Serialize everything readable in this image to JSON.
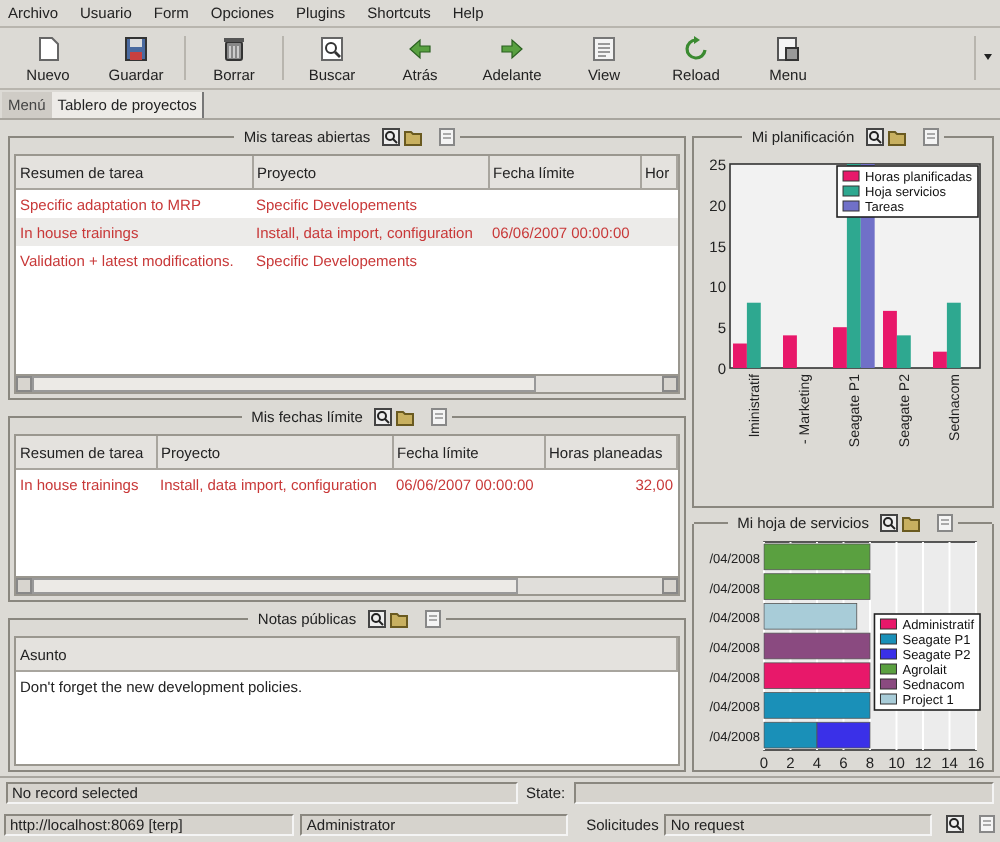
{
  "menu_bar": [
    "Archivo",
    "Usuario",
    "Form",
    "Opciones",
    "Plugins",
    "Shortcuts",
    "Help"
  ],
  "toolbar": [
    {
      "label": "Nuevo",
      "kind": "new"
    },
    {
      "label": "Guardar",
      "kind": "save"
    },
    {
      "label": "Borrar",
      "kind": "delete"
    },
    {
      "label": "Buscar",
      "kind": "search"
    },
    {
      "label": "Atrás",
      "kind": "back"
    },
    {
      "label": "Adelante",
      "kind": "forward"
    },
    {
      "label": "View",
      "kind": "view"
    },
    {
      "label": "Reload",
      "kind": "reload"
    },
    {
      "label": "Menu",
      "kind": "menu"
    }
  ],
  "tabs": [
    {
      "label": "Menú",
      "selected": false
    },
    {
      "label": "Tablero de proyectos",
      "selected": true
    }
  ],
  "open_tasks": {
    "title": "Mis tareas abiertas",
    "columns": [
      "Resumen de tarea",
      "Proyecto",
      "Fecha límite",
      "Hor"
    ],
    "rows": [
      {
        "cells": [
          "Specific adaptation to MRP",
          "Specific Developements",
          ""
        ],
        "selected": false
      },
      {
        "cells": [
          "In house trainings",
          "Install, data import, configuration",
          "06/06/2007 00:00:00"
        ],
        "selected": true
      },
      {
        "cells": [
          "Validation + latest modifications.",
          "Specific Developements",
          ""
        ],
        "selected": false
      }
    ]
  },
  "deadlines": {
    "title": "Mis fechas límite",
    "columns": [
      "Resumen de tarea",
      "Proyecto",
      "Fecha límite",
      "Horas planeadas"
    ],
    "rows": [
      {
        "cells": [
          "In house trainings",
          "Install, data import, configuration",
          "06/06/2007 00:00:00",
          "32,00"
        ],
        "selected": false
      }
    ]
  },
  "public_notes": {
    "title": "Notas públicas",
    "columns": [
      "Asunto"
    ],
    "rows": [
      {
        "cells": [
          "Don't forget the new development policies."
        ],
        "selected": false
      }
    ]
  },
  "planning": {
    "title": "Mi planificación",
    "chart_data": {
      "type": "bar",
      "orientation": "vertical",
      "legend": "upper right",
      "categories": [
        "lministratif",
        "- Marketing",
        "Seagate P1",
        "Seagate P2",
        "Sednacom"
      ],
      "ylim": [
        0,
        25
      ],
      "yticks": [
        0,
        5,
        10,
        15,
        20,
        25
      ],
      "series": [
        {
          "name": "Horas planificadas",
          "color": "#e8186a",
          "values": [
            3,
            4,
            5,
            7,
            2
          ]
        },
        {
          "name": "Hoja servicios",
          "color": "#2ea890",
          "values": [
            8,
            null,
            25,
            4,
            8
          ]
        },
        {
          "name": "Tareas",
          "color": "#7070c8",
          "values": [
            null,
            null,
            25,
            null,
            null
          ]
        }
      ]
    }
  },
  "timesheet": {
    "title": "Mi hoja de servicios",
    "chart_data": {
      "type": "bar",
      "orientation": "horizontal",
      "stacked": true,
      "grid": true,
      "legend": "center right",
      "categories": [
        "/04/2008",
        "/04/2008",
        "/04/2008",
        "/04/2008",
        "/04/2008",
        "/04/2008",
        "/04/2008"
      ],
      "xlim": [
        0,
        16
      ],
      "xticks": [
        0,
        2,
        4,
        6,
        8,
        10,
        12,
        14,
        16
      ],
      "series": [
        {
          "name": "Administratif",
          "color": "#e8186a",
          "values": [
            null,
            null,
            null,
            null,
            8,
            null,
            null
          ]
        },
        {
          "name": "Seagate P1",
          "color": "#1a90b8",
          "values": [
            null,
            null,
            null,
            null,
            null,
            8,
            4
          ]
        },
        {
          "name": "Seagate P2",
          "color": "#3a30e8",
          "values": [
            null,
            null,
            null,
            null,
            null,
            null,
            4
          ]
        },
        {
          "name": "Agrolait",
          "color": "#5aa040",
          "values": [
            8,
            8,
            null,
            null,
            null,
            null,
            null
          ]
        },
        {
          "name": "Sednacom",
          "color": "#8a4a80",
          "values": [
            null,
            null,
            null,
            8,
            null,
            null,
            null
          ]
        },
        {
          "name": "Project 1",
          "color": "#a8ccd8",
          "values": [
            null,
            null,
            7,
            null,
            null,
            null,
            null
          ]
        }
      ]
    }
  },
  "status_bar": {
    "message": "No record selected",
    "state_label": "State:"
  },
  "footer": {
    "server": "http://localhost:8069 [terp]",
    "user": "Administrator",
    "requests_label": "Solicitudes",
    "requests": "No request"
  }
}
